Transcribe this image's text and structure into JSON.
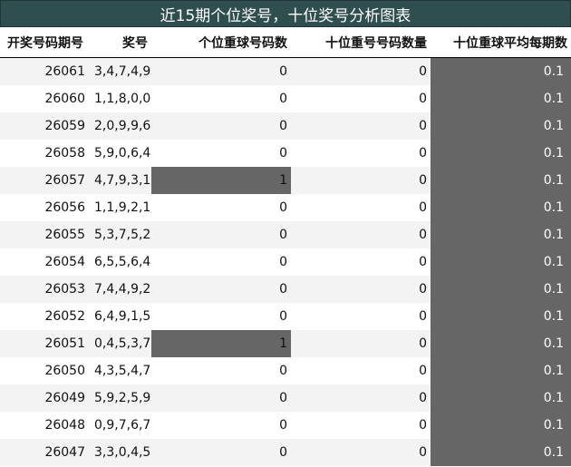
{
  "title": "近15期个位奖号，十位奖号分析图表",
  "columns": [
    "开奖号码期号",
    "奖号",
    "个位重球号码数",
    "十位重号号码数量",
    "十位重球平均每期数"
  ],
  "highlight_color": "#666666",
  "rows": [
    {
      "period": "26061",
      "draw": "3,4,7,4,9",
      "units_repeat": "0",
      "tens_repeat": "0",
      "tens_avg": "0.1"
    },
    {
      "period": "26060",
      "draw": "1,1,8,0,0",
      "units_repeat": "0",
      "tens_repeat": "0",
      "tens_avg": "0.1"
    },
    {
      "period": "26059",
      "draw": "2,0,9,9,6",
      "units_repeat": "0",
      "tens_repeat": "0",
      "tens_avg": "0.1"
    },
    {
      "period": "26058",
      "draw": "5,9,0,6,4",
      "units_repeat": "0",
      "tens_repeat": "0",
      "tens_avg": "0.1"
    },
    {
      "period": "26057",
      "draw": "4,7,9,3,1",
      "units_repeat": "1",
      "tens_repeat": "0",
      "tens_avg": "0.1"
    },
    {
      "period": "26056",
      "draw": "1,1,9,2,1",
      "units_repeat": "0",
      "tens_repeat": "0",
      "tens_avg": "0.1"
    },
    {
      "period": "26055",
      "draw": "5,3,7,5,2",
      "units_repeat": "0",
      "tens_repeat": "0",
      "tens_avg": "0.1"
    },
    {
      "period": "26054",
      "draw": "6,5,5,6,4",
      "units_repeat": "0",
      "tens_repeat": "0",
      "tens_avg": "0.1"
    },
    {
      "period": "26053",
      "draw": "7,4,4,9,2",
      "units_repeat": "0",
      "tens_repeat": "0",
      "tens_avg": "0.1"
    },
    {
      "period": "26052",
      "draw": "6,4,9,1,5",
      "units_repeat": "0",
      "tens_repeat": "0",
      "tens_avg": "0.1"
    },
    {
      "period": "26051",
      "draw": "0,4,5,3,7",
      "units_repeat": "1",
      "tens_repeat": "0",
      "tens_avg": "0.1"
    },
    {
      "period": "26050",
      "draw": "4,3,5,4,7",
      "units_repeat": "0",
      "tens_repeat": "0",
      "tens_avg": "0.1"
    },
    {
      "period": "26049",
      "draw": "5,9,2,5,9",
      "units_repeat": "0",
      "tens_repeat": "0",
      "tens_avg": "0.1"
    },
    {
      "period": "26048",
      "draw": "0,9,7,6,7",
      "units_repeat": "0",
      "tens_repeat": "0",
      "tens_avg": "0.1"
    },
    {
      "period": "26047",
      "draw": "3,3,0,4,5",
      "units_repeat": "0",
      "tens_repeat": "0",
      "tens_avg": "0.1"
    }
  ]
}
